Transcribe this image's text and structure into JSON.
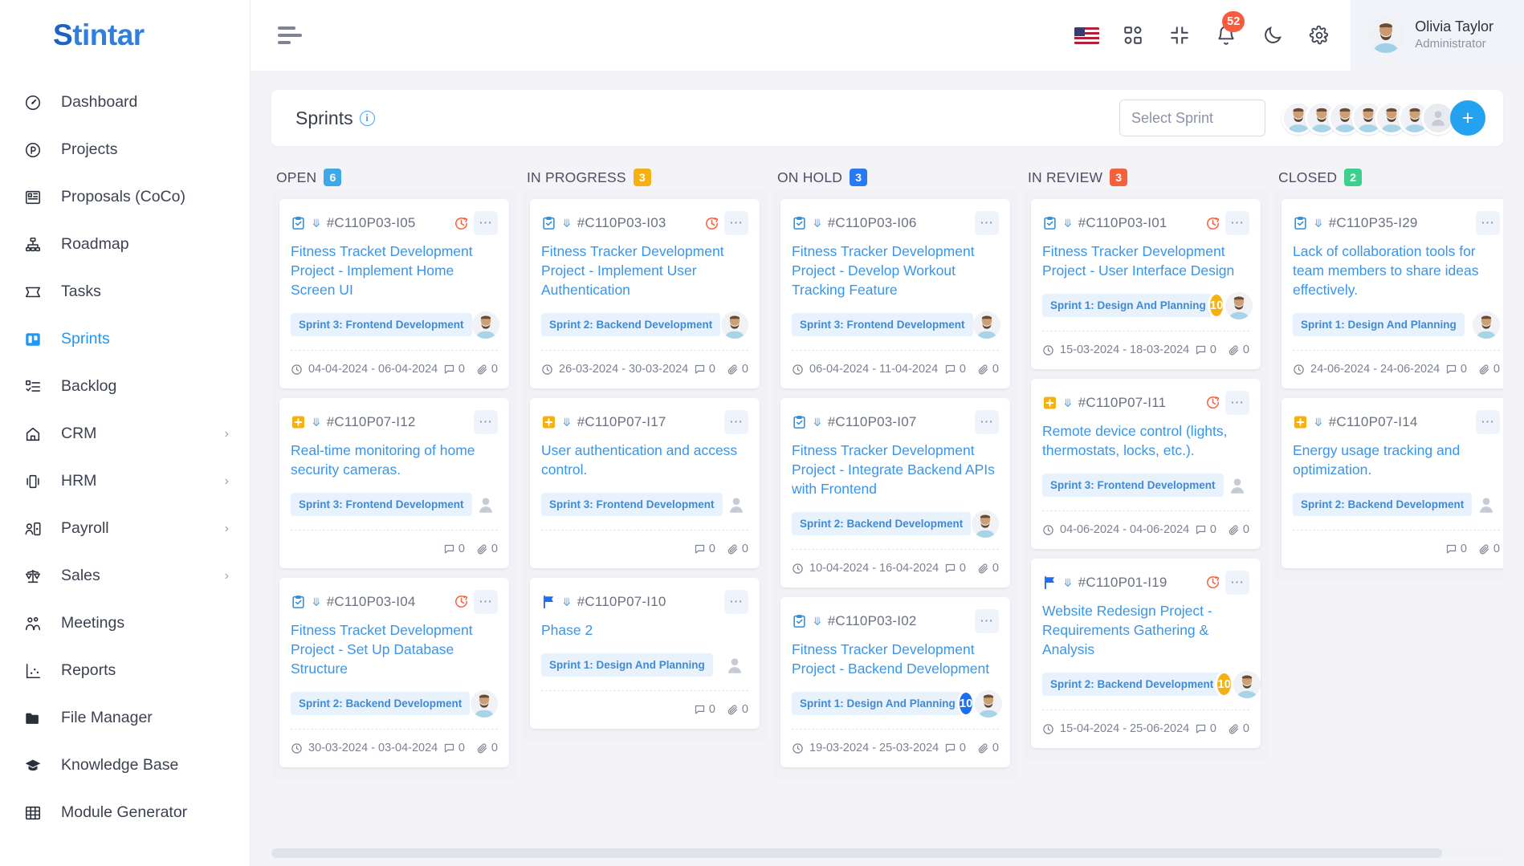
{
  "brand": {
    "name_s": "S",
    "name_rest": "tintar"
  },
  "sidebar": {
    "items": [
      {
        "label": "Dashboard",
        "icon": "gauge-icon",
        "active": false,
        "has_caret": false
      },
      {
        "label": "Projects",
        "icon": "projects-icon",
        "active": false,
        "has_caret": false
      },
      {
        "label": "Proposals (CoCo)",
        "icon": "proposals-icon",
        "active": false,
        "has_caret": false
      },
      {
        "label": "Roadmap",
        "icon": "roadmap-icon",
        "active": false,
        "has_caret": false
      },
      {
        "label": "Tasks",
        "icon": "tasks-icon",
        "active": false,
        "has_caret": false
      },
      {
        "label": "Sprints",
        "icon": "sprints-icon",
        "active": true,
        "has_caret": false
      },
      {
        "label": "Backlog",
        "icon": "backlog-icon",
        "active": false,
        "has_caret": false
      },
      {
        "label": "CRM",
        "icon": "crm-icon",
        "active": false,
        "has_caret": true
      },
      {
        "label": "HRM",
        "icon": "hrm-icon",
        "active": false,
        "has_caret": true
      },
      {
        "label": "Payroll",
        "icon": "payroll-icon",
        "active": false,
        "has_caret": true
      },
      {
        "label": "Sales",
        "icon": "sales-icon",
        "active": false,
        "has_caret": true
      },
      {
        "label": "Meetings",
        "icon": "meetings-icon",
        "active": false,
        "has_caret": false
      },
      {
        "label": "Reports",
        "icon": "reports-icon",
        "active": false,
        "has_caret": false
      },
      {
        "label": "File Manager",
        "icon": "folder-icon",
        "active": false,
        "has_caret": false
      },
      {
        "label": "Knowledge Base",
        "icon": "graduation-cap-icon",
        "active": false,
        "has_caret": false
      },
      {
        "label": "Module Generator",
        "icon": "grid-icon",
        "active": false,
        "has_caret": false
      }
    ]
  },
  "topbar": {
    "menu_toggle": "hamburger-icon",
    "language_flag": "us-flag-icon",
    "apps_icon": "apps-grid-icon",
    "fullscreen_icon": "compress-icon",
    "notifications_icon": "bell-icon",
    "notifications_count": "52",
    "dark_mode_icon": "moon-icon",
    "settings_icon": "gear-icon",
    "user": {
      "name": "Olivia Taylor",
      "role": "Administrator"
    }
  },
  "sprint_bar": {
    "title": "Sprints",
    "info_icon": "info-icon",
    "info_glyph": "i",
    "select_placeholder": "Select Sprint",
    "avatar_count": 6,
    "add_label": "+"
  },
  "colors": {
    "accent": "#24a2f0",
    "open": "#3fa9e8",
    "in_progress": "#f5b111",
    "on_hold": "#2979f5",
    "in_review": "#f4613c",
    "closed": "#3ecf8e",
    "card_title": "#3a95e8",
    "tag_bg": "#e8f2fc",
    "tag_text": "#4389cf"
  },
  "board": {
    "columns": [
      {
        "name": "OPEN",
        "count": "6",
        "count_color": "#3fa9e8",
        "cards": [
          {
            "type_icon": "clipboard-check-icon",
            "id": "#C110P03-I05",
            "title": "Fitness Tracket Development Project - Implement Home Screen UI",
            "tag": "Sprint 3: Frontend Development",
            "bubble": null,
            "has_assignee": true,
            "overdue": true,
            "dates": "04-04-2024 - 06-04-2024",
            "comments": "0",
            "attachments": "0"
          },
          {
            "type_icon": "plus-square-icon",
            "id": "#C110P07-I12",
            "title": "Real-time monitoring of home security cameras.",
            "tag": "Sprint 3: Frontend Development",
            "bubble": null,
            "has_assignee": false,
            "overdue": false,
            "dates": null,
            "comments": "0",
            "attachments": "0"
          },
          {
            "type_icon": "clipboard-check-icon",
            "id": "#C110P03-I04",
            "title": "Fitness Tracket Development Project - Set Up Database Structure",
            "tag": "Sprint 2: Backend Development",
            "bubble": null,
            "has_assignee": true,
            "overdue": true,
            "dates": "30-03-2024 - 03-04-2024",
            "comments": "0",
            "attachments": "0"
          }
        ]
      },
      {
        "name": "IN PROGRESS",
        "count": "3",
        "count_color": "#f5b111",
        "cards": [
          {
            "type_icon": "clipboard-check-icon",
            "id": "#C110P03-I03",
            "title": "Fitness Tracker Development Project - Implement User Authentication",
            "tag": "Sprint 2: Backend Development",
            "bubble": null,
            "has_assignee": true,
            "overdue": true,
            "dates": "26-03-2024 - 30-03-2024",
            "comments": "0",
            "attachments": "0"
          },
          {
            "type_icon": "plus-square-icon",
            "id": "#C110P07-I17",
            "title": "User authentication and access control.",
            "tag": "Sprint 3: Frontend Development",
            "bubble": null,
            "has_assignee": false,
            "overdue": false,
            "dates": null,
            "comments": "0",
            "attachments": "0"
          },
          {
            "type_icon": "flag-icon",
            "id": "#C110P07-I10",
            "title": "Phase 2",
            "tag": "Sprint 1: Design And Planning",
            "bubble": null,
            "has_assignee": false,
            "overdue": false,
            "dates": null,
            "comments": "0",
            "attachments": "0"
          }
        ]
      },
      {
        "name": "ON HOLD",
        "count": "3",
        "count_color": "#2979f5",
        "cards": [
          {
            "type_icon": "clipboard-check-icon",
            "id": "#C110P03-I06",
            "title": "Fitness Tracker Development Project - Develop Workout Tracking Feature",
            "tag": "Sprint 3: Frontend Development",
            "bubble": null,
            "has_assignee": true,
            "overdue": false,
            "dates": "06-04-2024 - 11-04-2024",
            "comments": "0",
            "attachments": "0"
          },
          {
            "type_icon": "clipboard-check-icon",
            "id": "#C110P03-I07",
            "title": "Fitness Tracker Development Project - Integrate Backend APIs with Frontend",
            "tag": "Sprint 2: Backend Development",
            "bubble": null,
            "has_assignee": true,
            "overdue": false,
            "dates": "10-04-2024 - 16-04-2024",
            "comments": "0",
            "attachments": "0"
          },
          {
            "type_icon": "clipboard-check-icon",
            "id": "#C110P03-I02",
            "title": "Fitness Tracker Development Project - Backend Development",
            "tag": "Sprint 1: Design And Planning",
            "bubble": {
              "value": "10",
              "color": "blue"
            },
            "has_assignee": true,
            "overdue": false,
            "dates": "19-03-2024 - 25-03-2024",
            "comments": "0",
            "attachments": "0"
          }
        ]
      },
      {
        "name": "IN REVIEW",
        "count": "3",
        "count_color": "#f4613c",
        "cards": [
          {
            "type_icon": "clipboard-check-icon",
            "id": "#C110P03-I01",
            "title": "Fitness Tracker Development Project - User Interface Design",
            "tag": "Sprint 1: Design And Planning",
            "bubble": {
              "value": "10",
              "color": "orange"
            },
            "has_assignee": true,
            "overdue": true,
            "dates": "15-03-2024 - 18-03-2024",
            "comments": "0",
            "attachments": "0"
          },
          {
            "type_icon": "plus-square-icon",
            "id": "#C110P07-I11",
            "title": "Remote device control (lights, thermostats, locks, etc.).",
            "tag": "Sprint 3: Frontend Development",
            "bubble": null,
            "has_assignee": false,
            "overdue": true,
            "dates": "04-06-2024 - 04-06-2024",
            "comments": "0",
            "attachments": "0"
          },
          {
            "type_icon": "flag-icon",
            "id": "#C110P01-I19",
            "title": "Website Redesign Project - Requirements Gathering & Analysis",
            "tag": "Sprint 2: Backend Development",
            "bubble": {
              "value": "10",
              "color": "orange"
            },
            "has_assignee": true,
            "overdue": true,
            "dates": "15-04-2024 - 25-06-2024",
            "comments": "0",
            "attachments": "0"
          }
        ]
      },
      {
        "name": "CLOSED",
        "count": "2",
        "count_color": "#3ecf8e",
        "cards": [
          {
            "type_icon": "clipboard-check-icon",
            "id": "#C110P35-I29",
            "title": "Lack of collaboration tools for team members to share ideas effectively.",
            "tag": "Sprint 1: Design And Planning",
            "bubble": null,
            "has_assignee": true,
            "overdue": false,
            "dates": "24-06-2024 - 24-06-2024",
            "comments": "0",
            "attachments": "0"
          },
          {
            "type_icon": "plus-square-icon",
            "id": "#C110P07-I14",
            "title": "Energy usage tracking and optimization.",
            "tag": "Sprint 2: Backend Development",
            "bubble": null,
            "has_assignee": false,
            "overdue": false,
            "dates": null,
            "comments": "0",
            "attachments": "0"
          }
        ]
      }
    ]
  }
}
